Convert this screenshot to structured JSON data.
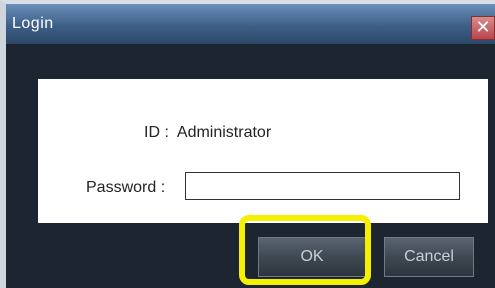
{
  "window": {
    "title": "Login",
    "close_glyph": "✕",
    "close_icon": "close-icon"
  },
  "form": {
    "id_label": "ID :",
    "id_value": "Administrator",
    "password_label": "Password :",
    "password_value": ""
  },
  "buttons": {
    "ok_label": "OK",
    "cancel_label": "Cancel"
  },
  "colors": {
    "highlight": "#f4f000",
    "titlebar": "#3d5f86",
    "close_button": "#b8454a"
  }
}
